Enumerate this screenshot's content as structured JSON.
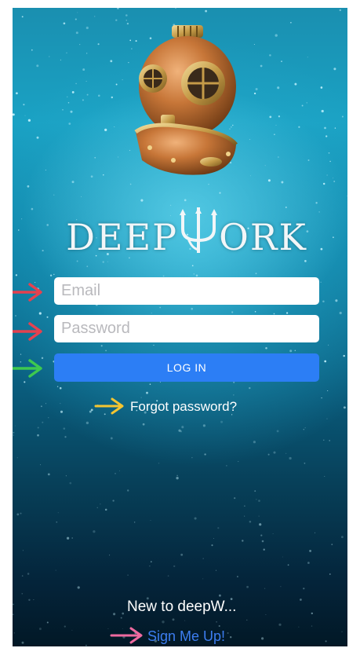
{
  "app": {
    "logo_text_left": "DEEP",
    "logo_text_right": "ORK"
  },
  "login_form": {
    "email_placeholder": "Email",
    "password_placeholder": "Password",
    "login_label": "LOG IN",
    "forgot_label": "Forgot password?"
  },
  "footer": {
    "new_to_text": "New to deepW...",
    "signup_label": "Sign Me Up!"
  },
  "annotations": [
    {
      "target": "email-field",
      "color": "#e5414f"
    },
    {
      "target": "password-field",
      "color": "#e5414f"
    },
    {
      "target": "login-button",
      "color": "#3ec94f"
    },
    {
      "target": "forgot-password-link",
      "color": "#f4c531"
    },
    {
      "target": "sign-up-link",
      "color": "#ef6aa0"
    }
  ],
  "colors": {
    "primary_button": "#2c7ef5",
    "link": "#3c7df0"
  },
  "icons": [
    "diving-helmet-icon",
    "trident-icon"
  ]
}
